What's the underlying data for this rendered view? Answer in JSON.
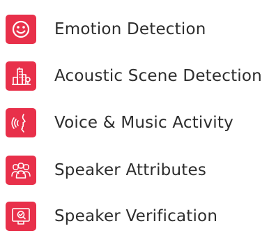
{
  "accent_color": "#e8304a",
  "features": [
    {
      "label": "Emotion Detection",
      "icon": "smiley-face-icon"
    },
    {
      "label": "Acoustic Scene Detection",
      "icon": "city-scene-icon"
    },
    {
      "label": "Voice & Music Activity",
      "icon": "voice-activity-icon"
    },
    {
      "label": "Speaker Attributes",
      "icon": "speaker-group-icon"
    },
    {
      "label": "Speaker Verification",
      "icon": "speaker-verification-icon"
    }
  ]
}
